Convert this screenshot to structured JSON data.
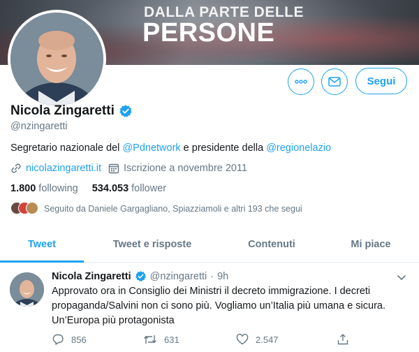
{
  "banner": {
    "line1": "DALLA PARTE DELLE",
    "line2": "PERSONE"
  },
  "profile": {
    "name": "Nicola Zingaretti",
    "handle": "@nzingaretti",
    "bio_prefix": "Segretario nazionale del ",
    "bio_mention1": "@Pdnetwork",
    "bio_middle": " e presidente della ",
    "bio_mention2": "@regionelazio",
    "website": "nicolazingaretti.it",
    "joined": "Iscrizione a novembre 2011",
    "following_count": "1.800",
    "following_label": "following",
    "followers_count": "534.053",
    "followers_label": "follower",
    "followed_by": "Seguito da Daniele Gargagliano, Spiazziamoli e altri 193 che segui"
  },
  "actions": {
    "follow_label": "Segui"
  },
  "tabs": [
    {
      "label": "Tweet",
      "active": true
    },
    {
      "label": "Tweet e risposte",
      "active": false
    },
    {
      "label": "Contenuti",
      "active": false
    },
    {
      "label": "Mi piace",
      "active": false
    }
  ],
  "tweet": {
    "name": "Nicola Zingaretti",
    "handle": "@nzingaretti",
    "separator": "·",
    "time": "9h",
    "line1": "Approvato ora in Consiglio dei Ministri il decreto immigrazione. I decreti",
    "line2": "propaganda/Salvini non ci sono più. Vogliamo un’Italia  più umana e sicura.",
    "line3": "Un’Europa più protagonista",
    "replies": "856",
    "retweets": "631",
    "likes": "2.547"
  },
  "colors": {
    "accent": "#1da1f2",
    "muted": "#657786",
    "text": "#14171a",
    "retweet_icon": "#657786"
  },
  "icons": [
    "more-icon",
    "mail-icon",
    "verified-icon",
    "link-icon",
    "calendar-icon",
    "chevron-down-icon",
    "reply-icon",
    "retweet-icon",
    "like-icon",
    "share-icon"
  ]
}
